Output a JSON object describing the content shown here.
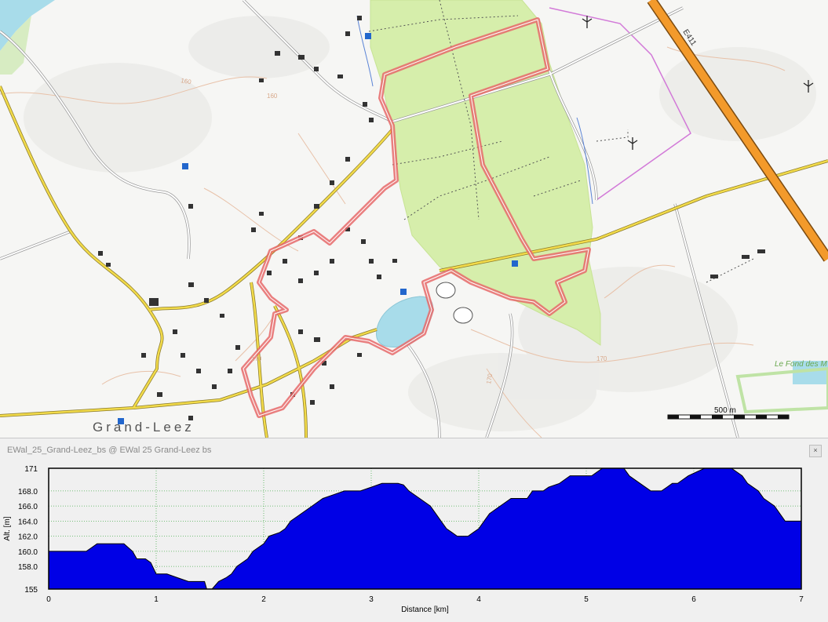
{
  "map": {
    "place_name": "Grand-Leez",
    "road_label": "E411",
    "locality_label": "Le Fond des M",
    "scale_label": "500 m",
    "contour_labels": [
      "160",
      "170",
      "160",
      "170",
      "170"
    ],
    "colors": {
      "forest": "#d6eeab",
      "track": "#e66a6a",
      "highway": "#f39a2b",
      "lake": "#a8dcea"
    }
  },
  "panel": {
    "title": "EWal_25_Grand-Leez_bs @ EWal 25 Grand-Leez bs",
    "close_label": "×"
  },
  "chart_data": {
    "type": "area",
    "xlabel": "Distance [km]",
    "ylabel": "Alt. [m]",
    "xlim": [
      0,
      7
    ],
    "ylim": [
      155,
      171
    ],
    "x_ticks": [
      "0",
      "1",
      "2",
      "3",
      "4",
      "5",
      "6",
      "7"
    ],
    "y_ticks": [
      "155",
      "158.0",
      "160.0",
      "162.0",
      "164.0",
      "166.0",
      "168.0",
      "171"
    ],
    "y_tick_values": [
      155,
      158,
      160,
      162,
      164,
      166,
      168,
      171
    ],
    "grid": true,
    "fill_color": "#0000e6",
    "points": [
      [
        0,
        160
      ],
      [
        0.35,
        160
      ],
      [
        0.4,
        160.5
      ],
      [
        0.45,
        161
      ],
      [
        0.7,
        161
      ],
      [
        0.78,
        160
      ],
      [
        0.82,
        159
      ],
      [
        0.9,
        159
      ],
      [
        0.95,
        158.5
      ],
      [
        1.0,
        157
      ],
      [
        1.1,
        157
      ],
      [
        1.2,
        156.5
      ],
      [
        1.3,
        156
      ],
      [
        1.45,
        156
      ],
      [
        1.47,
        155
      ],
      [
        1.52,
        155
      ],
      [
        1.58,
        156
      ],
      [
        1.65,
        156.5
      ],
      [
        1.7,
        157
      ],
      [
        1.75,
        158
      ],
      [
        1.85,
        159
      ],
      [
        1.9,
        160
      ],
      [
        2.0,
        161
      ],
      [
        2.05,
        162
      ],
      [
        2.15,
        162.5
      ],
      [
        2.2,
        163
      ],
      [
        2.25,
        164
      ],
      [
        2.35,
        165
      ],
      [
        2.45,
        166
      ],
      [
        2.55,
        167
      ],
      [
        2.65,
        167.5
      ],
      [
        2.75,
        168
      ],
      [
        2.9,
        168
      ],
      [
        3.0,
        168.5
      ],
      [
        3.1,
        169
      ],
      [
        3.25,
        169
      ],
      [
        3.3,
        168.8
      ],
      [
        3.35,
        168
      ],
      [
        3.45,
        167
      ],
      [
        3.55,
        166
      ],
      [
        3.6,
        165
      ],
      [
        3.65,
        164
      ],
      [
        3.7,
        163
      ],
      [
        3.75,
        162.5
      ],
      [
        3.8,
        162
      ],
      [
        3.9,
        162
      ],
      [
        3.95,
        162.5
      ],
      [
        4.0,
        163
      ],
      [
        4.05,
        164
      ],
      [
        4.1,
        165
      ],
      [
        4.2,
        166
      ],
      [
        4.3,
        167
      ],
      [
        4.45,
        167
      ],
      [
        4.5,
        168
      ],
      [
        4.6,
        168
      ],
      [
        4.65,
        168.5
      ],
      [
        4.75,
        169
      ],
      [
        4.85,
        170
      ],
      [
        5.05,
        170
      ],
      [
        5.1,
        170.5
      ],
      [
        5.15,
        171
      ],
      [
        5.35,
        171
      ],
      [
        5.4,
        170
      ],
      [
        5.5,
        169
      ],
      [
        5.6,
        168
      ],
      [
        5.7,
        168
      ],
      [
        5.75,
        168.5
      ],
      [
        5.8,
        169
      ],
      [
        5.85,
        169
      ],
      [
        5.95,
        170
      ],
      [
        6.1,
        171
      ],
      [
        6.35,
        171
      ],
      [
        6.45,
        170
      ],
      [
        6.5,
        169
      ],
      [
        6.6,
        168
      ],
      [
        6.65,
        167
      ],
      [
        6.75,
        166
      ],
      [
        6.8,
        165
      ],
      [
        6.85,
        164
      ],
      [
        7.0,
        164
      ]
    ]
  }
}
